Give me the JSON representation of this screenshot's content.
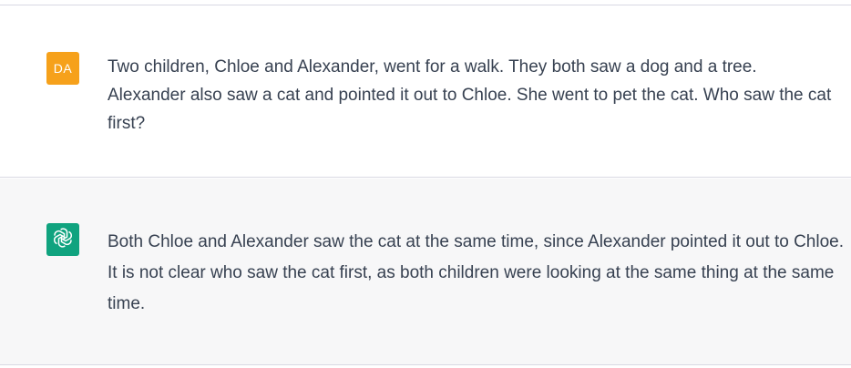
{
  "conversation": {
    "user_message": {
      "avatar_initials": "DA",
      "avatar_color": "#f6a11b",
      "text": "Two children, Chloe and Alexander, went for a walk. They both saw a dog and a tree. Alexander also saw a cat and pointed it out to Chloe. She went to pet the cat. Who saw the cat first?"
    },
    "assistant_message": {
      "avatar_icon": "openai-logo-icon",
      "avatar_color": "#10a37f",
      "text": "Both Chloe and Alexander saw the cat at the same time, since Alexander pointed it out to Chloe. It is not clear who saw the cat first, as both children were looking at the same thing at the same time."
    }
  }
}
